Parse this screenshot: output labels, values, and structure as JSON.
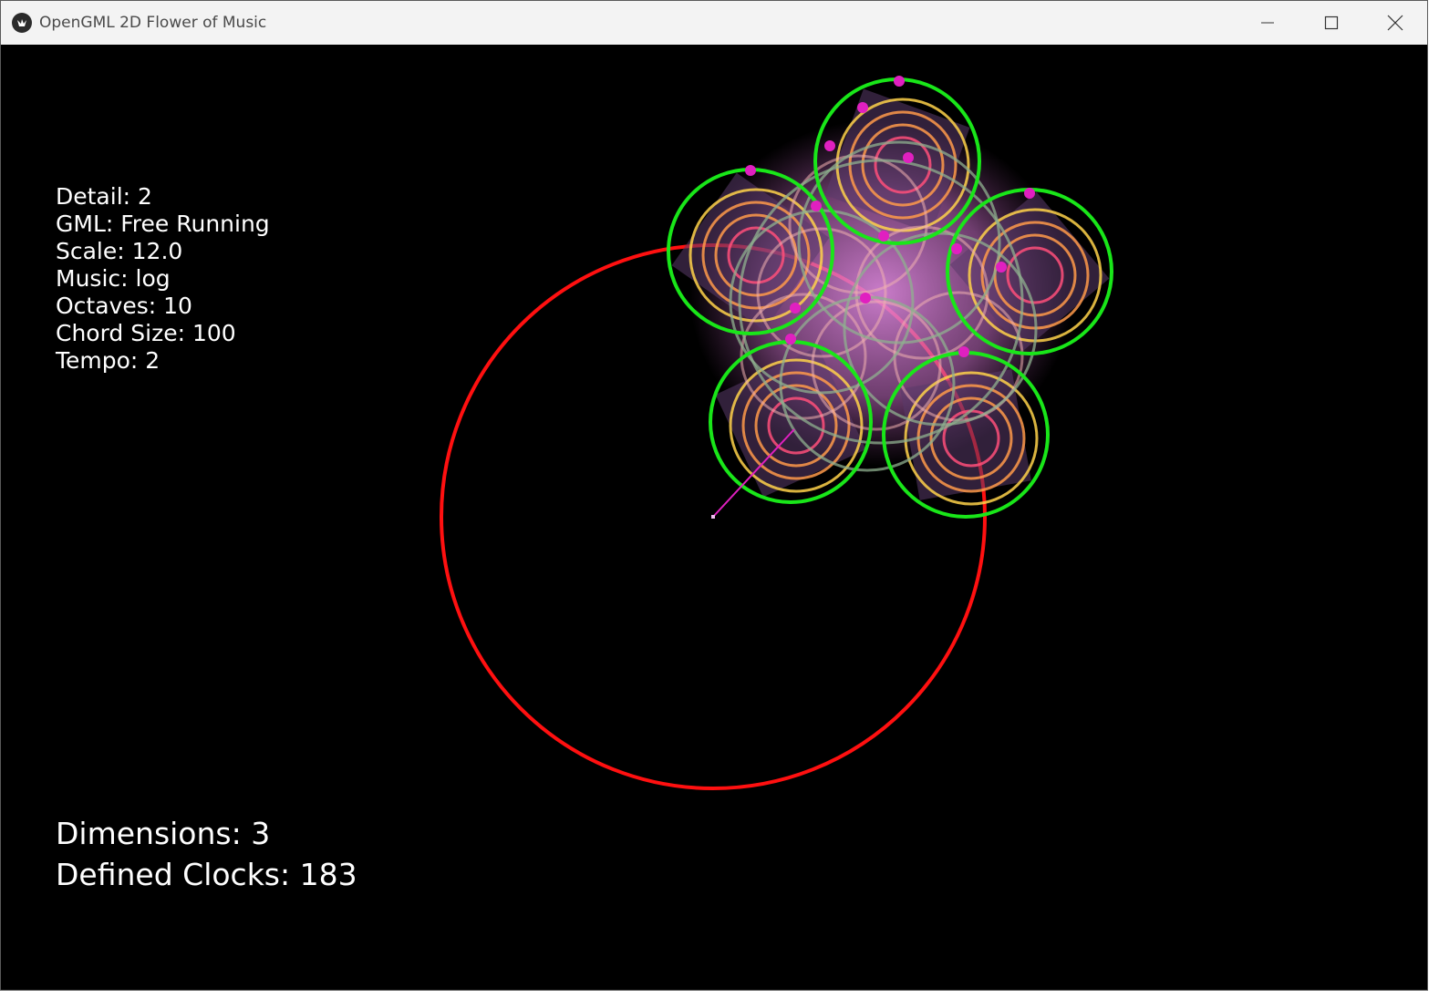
{
  "window": {
    "title": "OpenGML 2D Flower of Music",
    "controls": [
      "minimize",
      "maximize",
      "close"
    ]
  },
  "hud": {
    "detail": "Detail: 2",
    "gml": "GML: Free Running",
    "scale": "Scale: 12.0",
    "music": "Music: log",
    "octaves": "Octaves: 10",
    "chord_size": "Chord Size: 100",
    "tempo": "Tempo: 2"
  },
  "stats": {
    "dimensions": "Dimensions: 3",
    "defined_clocks": "Defined Clocks: 183"
  },
  "colors": {
    "background": "#000000",
    "outer_circle": "#ff1010",
    "petal_circle": "#19e619",
    "inner_ring_yellow": "#ffd24a",
    "inner_ring_orange": "#ff9a4a",
    "inner_ring_pink": "#ff4f7a",
    "fill_pink": "#d67ad6",
    "marker": "#e020c0"
  }
}
